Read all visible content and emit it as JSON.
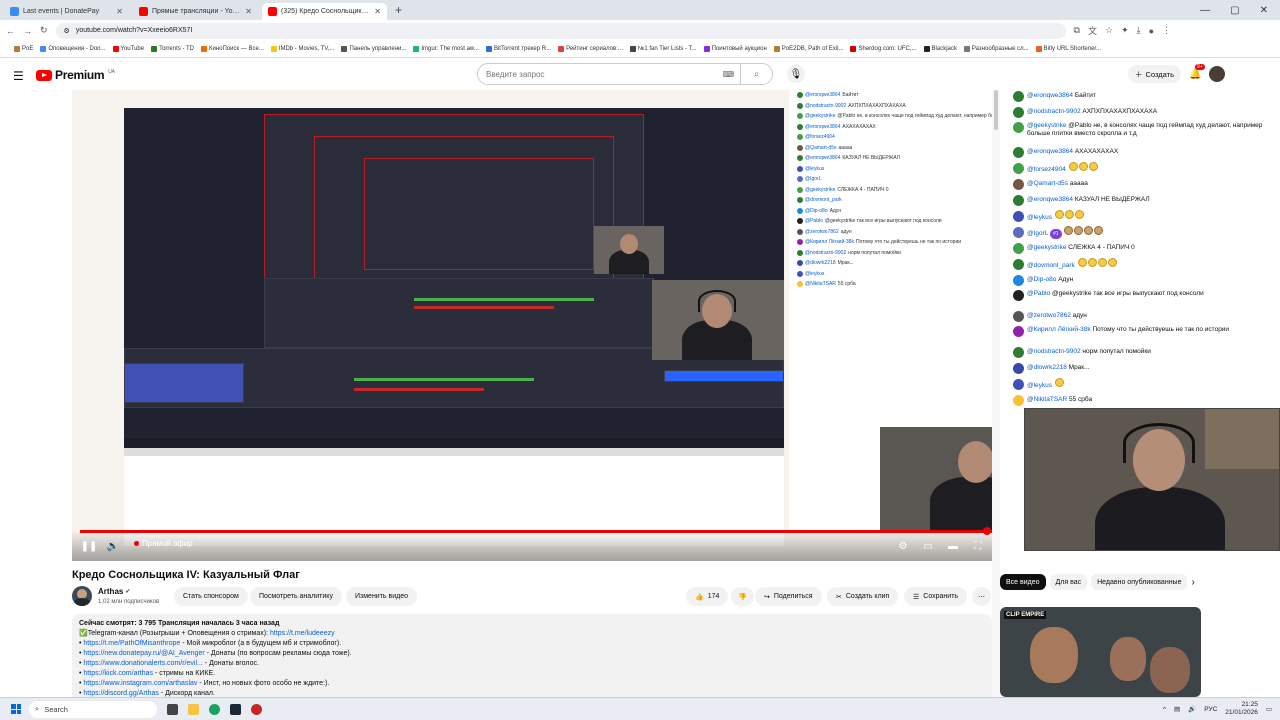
{
  "browser": {
    "tabs": [
      {
        "label": "Last events | DonatePay",
        "color": "#3c8df2",
        "active": false
      },
      {
        "label": "Прямые трансляции - YouTube",
        "color": "#ff0000",
        "active": false
      },
      {
        "label": "(325) Кредо Соснольщика IV: К",
        "color": "#ff0000",
        "active": true
      }
    ],
    "new_tab": "+",
    "url": "youtube.com/watch?v=Xxeeio6RX57I",
    "bookmarks": [
      {
        "label": "PoE",
        "color": "#b08030"
      },
      {
        "label": "Оповещения - Don...",
        "color": "#3c8df2"
      },
      {
        "label": "YouTube",
        "color": "#ff0000"
      },
      {
        "label": "Torrents - TD",
        "color": "#2a7a2a"
      },
      {
        "label": "КиноПоиск — Все...",
        "color": "#ff6600"
      },
      {
        "label": "IMDb - Movies, TV,...",
        "color": "#f5c518"
      },
      {
        "label": "Панель управлени...",
        "color": "#555"
      },
      {
        "label": "Imgur: The most aw...",
        "color": "#1bb76e"
      },
      {
        "label": "BitTorrent трекер R...",
        "color": "#2a6fd8"
      },
      {
        "label": "Рейтинг сериалов:...",
        "color": "#e04040"
      },
      {
        "label": "№1 fan Tier Lists - T...",
        "color": "#444"
      },
      {
        "label": "Поинтовый аукцион",
        "color": "#8a2be2"
      },
      {
        "label": "PoE2DB, Path of Exil...",
        "color": "#b08030"
      },
      {
        "label": "Sherdog.com: UFC,...",
        "color": "#c00"
      },
      {
        "label": "Blackjack",
        "color": "#222"
      },
      {
        "label": "Разнообразные сл...",
        "color": "#777"
      },
      {
        "label": "Bitly URL Shortener...",
        "color": "#ee6123"
      }
    ]
  },
  "youtube": {
    "logo_text": "Premium",
    "logo_region": "UA",
    "search_placeholder": "Введите запрос",
    "create_label": "Создать",
    "notif_count": "9+"
  },
  "player": {
    "live_label": "Прямой эфир",
    "progress": 1.0
  },
  "video": {
    "title": "Кредо Соснольщика IV: Казуальный Флаг",
    "channel": "Arthas",
    "subscribers": "1,02 млн подписчиков",
    "sponsor_label": "Стать спонсором",
    "analytics_label": "Посмотреть аналитику",
    "edit_label": "Изменить видео",
    "likes": "174",
    "share_label": "Поделиться",
    "clip_label": "Создать клип",
    "save_label": "Сохранить"
  },
  "description": {
    "stats": "Сейчас смотрят: 3 795  Трансляция началась 3 часа назад",
    "lines": [
      {
        "text": "Telegram-канал (Розыгрыши + Оповещения о стримах): ",
        "link": "https://t.me/ludeeezy"
      },
      {
        "link": "https://t.me/PathOfMisanthrope",
        "text": " - Мой микроблог (а в будущем мб и стримоблог)."
      },
      {
        "link": "https://new.donatepay.ru/@AI_Avenger",
        "text": " - Донаты (по вопросам рекламы сюда тоже)."
      },
      {
        "link": "https://www.donationalerts.com/r/evil...",
        "text": " - Донаты вголос."
      },
      {
        "link": "https://kick.com/arthas",
        "text": " - стримы на КИКЕ."
      },
      {
        "link": "https://www.instagram.com/arthaslav",
        "text": " - Инст, но новых фото особо не ждите:)."
      },
      {
        "link": "https://discord.gg/Arthas",
        "text": " - Дискорд канал."
      }
    ]
  },
  "recommend": {
    "chips": [
      "Все видео",
      "Для вас",
      "Недавно опубликованные"
    ],
    "thumb_title": "CLIP EMPIRE"
  },
  "chat": [
    {
      "user": "@eronqwe3864",
      "msg": "Байтит",
      "emojis": 0,
      "color": "#2e7d32"
    },
    {
      "user": "@nodstractn-9902",
      "msg": "АХПХПХАХАХПХАХАХА",
      "emojis": 0,
      "color": "#2e7d32"
    },
    {
      "user": "@geekystrike",
      "msg": "@Pablo не, в консолях чаще под геймпад худ делают, например больше плитки вместо скролла и т.д",
      "emojis": 0,
      "color": "#43a047"
    },
    {
      "user": "@eronqwe3864",
      "msg": "АХАХАХАХАХ",
      "emojis": 0,
      "color": "#2e7d32"
    },
    {
      "user": "@forsez4904",
      "msg": "",
      "emojis": 3,
      "color": "#43a047"
    },
    {
      "user": "@Qamart-d5s",
      "msg": "ааааа",
      "emojis": 0,
      "color": "#795548"
    },
    {
      "user": "@eronqwe3864",
      "msg": "КАЗУАЛ НЕ ВЫДЕРЖАЛ",
      "emojis": 0,
      "color": "#2e7d32"
    },
    {
      "user": "@leykus",
      "msg": "",
      "emojis": 3,
      "color": "#3f51b5"
    },
    {
      "user": "@IgorL",
      "msg": "",
      "emojis": 4,
      "color": "#5c6bc0",
      "badge": "#1"
    },
    {
      "user": "@geekystrike",
      "msg": "СЛЕЖКА 4 - ПАПИЧ 0",
      "emojis": 0,
      "color": "#43a047"
    },
    {
      "user": "@dovmont_park",
      "msg": "",
      "emojis": 4,
      "color": "#2e7d32"
    },
    {
      "user": "@Dip-o8o",
      "msg": "Адун",
      "emojis": 0,
      "color": "#1e88e5"
    },
    {
      "user": "@Pablo",
      "msg": "@geekystrike так все игры выпускают под консоли",
      "emojis": 0,
      "color": "#222"
    },
    {
      "user": "@zerotwo7862",
      "msg": "адун",
      "emojis": 0,
      "color": "#555"
    },
    {
      "user": "@Кирилл Лёгкий-38k",
      "msg": "Потому что ты действуешь не так по истории",
      "emojis": 0,
      "color": "#8e24aa"
    },
    {
      "user": "@nodstractn-9902",
      "msg": "норм попутал помойки",
      "emojis": 0,
      "color": "#2e7d32"
    },
    {
      "user": "@dlowrk2218",
      "msg": "Мрак...",
      "emojis": 0,
      "color": "#3949ab"
    },
    {
      "user": "@leykus",
      "msg": "",
      "emojis": 1,
      "color": "#3f51b5"
    },
    {
      "user": "@NikitaTSAR",
      "msg": "55 срба",
      "emojis": 0,
      "color": "#fbc02d"
    }
  ],
  "taskbar": {
    "search_label": "Search",
    "lang": "РУС",
    "time": "21:25",
    "date": "21/01/2026"
  }
}
